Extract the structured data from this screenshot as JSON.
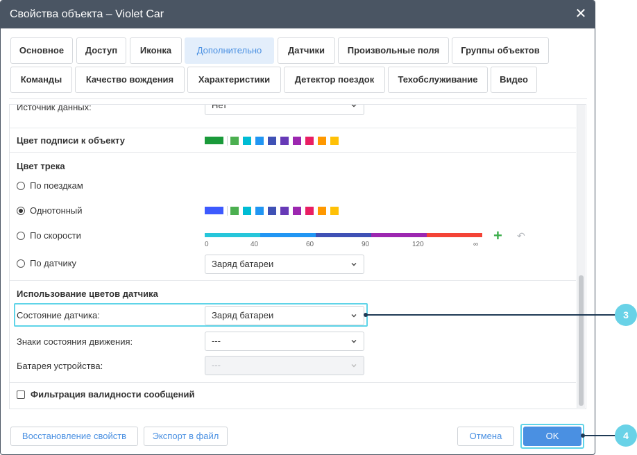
{
  "dialog": {
    "title": "Свойства объекта – Violet Car",
    "close_icon": "close-icon"
  },
  "tabs": [
    {
      "label": "Основное",
      "active": false
    },
    {
      "label": "Доступ",
      "active": false
    },
    {
      "label": "Иконка",
      "active": false
    },
    {
      "label": "Дополнительно",
      "active": true
    },
    {
      "label": "Датчики",
      "active": false
    },
    {
      "label": "Произвольные поля",
      "active": false
    },
    {
      "label": "Группы объектов",
      "active": false
    },
    {
      "label": "Команды",
      "active": false
    },
    {
      "label": "Качество вождения",
      "active": false
    },
    {
      "label": "Характеристики",
      "active": false
    },
    {
      "label": "Детектор поездок",
      "active": false
    },
    {
      "label": "Техобслуживание",
      "active": false
    },
    {
      "label": "Видео",
      "active": false
    }
  ],
  "form": {
    "data_source_label": "Источник данных:",
    "data_source_value": "Нет",
    "label_color_title": "Цвет подписи к объекту",
    "track_color_title": "Цвет трека",
    "track_options": [
      {
        "label": "По поездкам",
        "selected": false
      },
      {
        "label": "Однотонный",
        "selected": true
      },
      {
        "label": "По скорости",
        "selected": false
      },
      {
        "label": "По датчику",
        "selected": false
      }
    ],
    "by_sensor_value": "Заряд батареи",
    "speed_ticks": [
      "0",
      "40",
      "60",
      "90",
      "120",
      "∞"
    ],
    "sensor_colors_title": "Использование цветов датчика",
    "sensor_state_label": "Состояние датчика:",
    "sensor_state_value": "Заряд батареи",
    "motion_signs_label": "Знаки состояния движения:",
    "motion_signs_value": "---",
    "device_battery_label": "Батарея устройства:",
    "device_battery_value": "---",
    "filter_label": "Фильтрация валидности сообщений"
  },
  "colors": {
    "label_selected": "#1a9a3a",
    "track_selected": "#3d5afe",
    "palette": [
      "#4caf50",
      "#00bcd4",
      "#2196f3",
      "#3f51b5",
      "#673ab7",
      "#9c27b0",
      "#e91e63",
      "#ff9800",
      "#ffc107"
    ],
    "speed_gradient": [
      "#26c6da",
      "#2196f3",
      "#3f51b5",
      "#9c27b0",
      "#f44336"
    ],
    "accent": "#4a90e2",
    "callout": "#69d2e7"
  },
  "footer": {
    "restore_label": "Восстановление свойств",
    "export_label": "Экспорт в файл",
    "cancel_label": "Отмена",
    "ok_label": "OK"
  },
  "callouts": [
    "3",
    "4"
  ]
}
